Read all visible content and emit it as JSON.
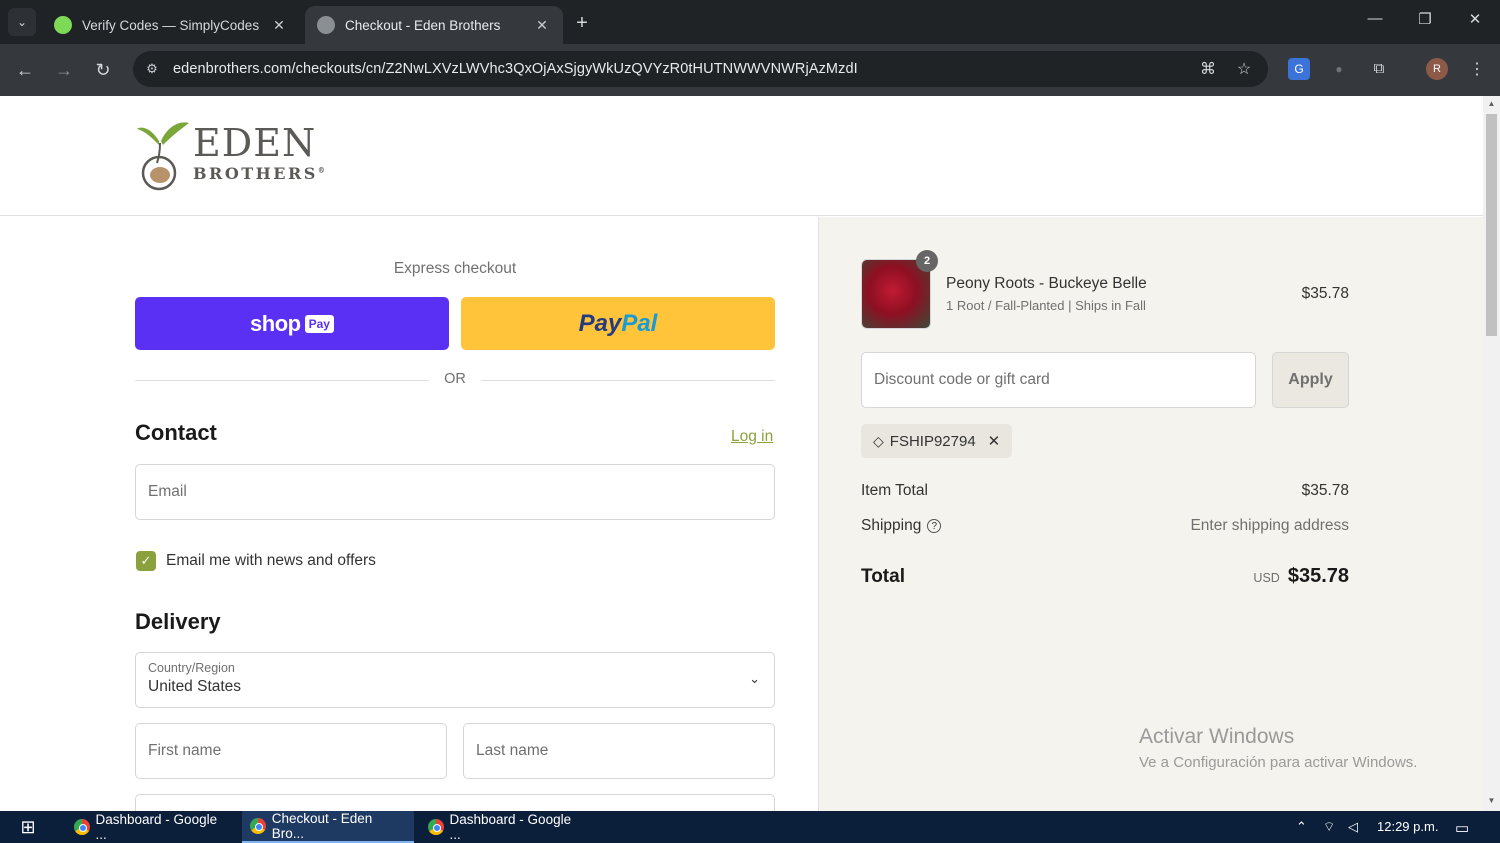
{
  "browser": {
    "tabs": [
      {
        "label": "Verify Codes — SimplyCodes",
        "active": false
      },
      {
        "label": "Checkout - Eden Brothers",
        "active": true
      }
    ],
    "url": "edenbrothers.com/checkouts/cn/Z2NwLXVzLWVhc3QxOjAxSjgyWkUzQVYzR0tHUTNWWVNWRjAzMzdI",
    "profile_initial": "R"
  },
  "store": {
    "logo_main": "EDEN",
    "logo_sub": "BROTHERS",
    "logo_mark": "®"
  },
  "checkout": {
    "express_label": "Express checkout",
    "shoppay_text": "shop",
    "shoppay_badge": "Pay",
    "paypal_p1": "Pay",
    "paypal_p2": "Pal",
    "or_label": "OR",
    "contact_title": "Contact",
    "login_label": "Log in",
    "email_placeholder": "Email",
    "newsletter_label": "Email me with news and offers",
    "newsletter_checked": true,
    "delivery_title": "Delivery",
    "country_label": "Country/Region",
    "country_value": "United States",
    "first_name_placeholder": "First name",
    "last_name_placeholder": "Last name"
  },
  "summary": {
    "item": {
      "name": "Peony Roots - Buckeye Belle",
      "variant": "1 Root / Fall-Planted | Ships in Fall",
      "price": "$35.78",
      "quantity": "2"
    },
    "discount_placeholder": "Discount code or gift card",
    "apply_label": "Apply",
    "applied_code": "FSHIP92794",
    "item_total_label": "Item Total",
    "item_total_value": "$35.78",
    "shipping_label": "Shipping",
    "shipping_value": "Enter shipping address",
    "total_label": "Total",
    "total_currency": "USD",
    "total_value": "$35.78"
  },
  "watermark": {
    "line1": "Activar Windows",
    "line2": "Ve a Configuración para activar Windows."
  },
  "taskbar": {
    "items": [
      {
        "label": "Dashboard - Google ...",
        "active": false
      },
      {
        "label": "Checkout - Eden Bro...",
        "active": true
      },
      {
        "label": "Dashboard - Google ...",
        "active": false
      }
    ],
    "time": "12:29 p.m."
  },
  "colors": {
    "accent_green": "#8ba13d",
    "shoppay_purple": "#5a31f4",
    "paypal_yellow": "#ffc439",
    "summary_bg": "#f5f3ee"
  }
}
